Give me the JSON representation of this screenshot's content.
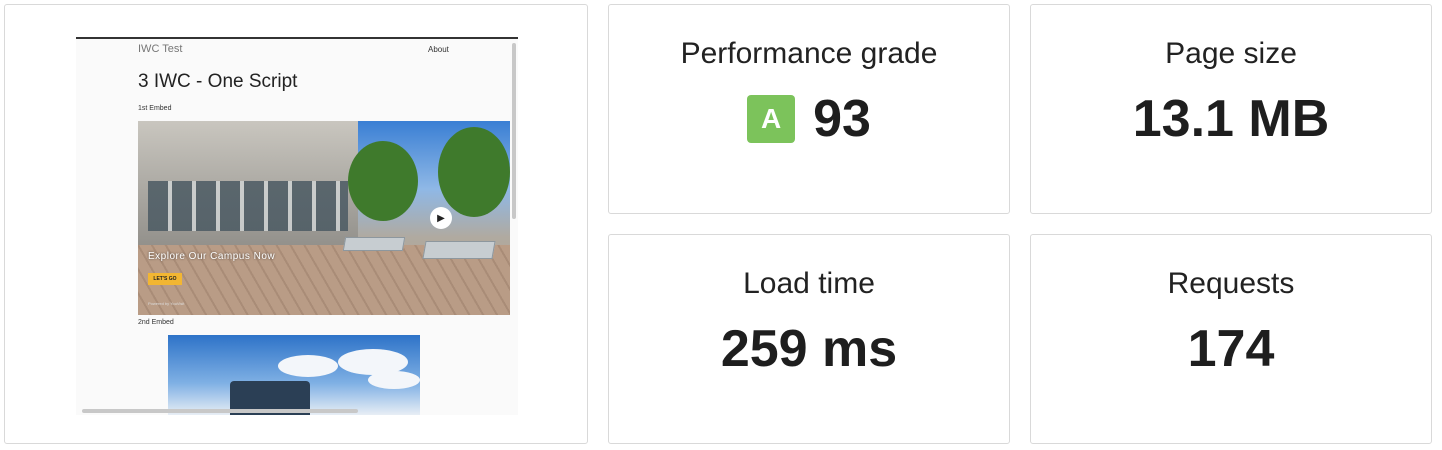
{
  "thumbnail": {
    "site_title": "IWC Test",
    "nav_link": "About",
    "heading": "3 IWC - One Script",
    "embed1_label": "1st Embed",
    "embed1_caption": "Explore Our Campus Now",
    "embed1_cta": "LET'S GO",
    "embed1_powered": "Powered by YouVisit",
    "embed2_label": "2nd Embed",
    "play_icon": "play-icon"
  },
  "metrics": {
    "grade": {
      "title": "Performance grade",
      "letter": "A",
      "score": "93",
      "badge_color": "#7cc35b"
    },
    "page_size": {
      "title": "Page size",
      "value": "13.1 MB"
    },
    "load_time": {
      "title": "Load time",
      "value": "259 ms"
    },
    "requests": {
      "title": "Requests",
      "value": "174"
    }
  }
}
